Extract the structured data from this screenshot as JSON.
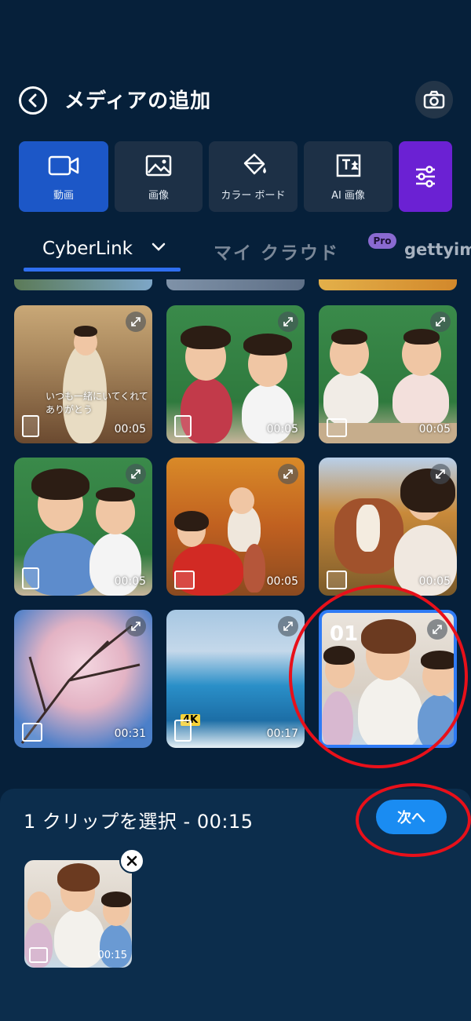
{
  "header": {
    "title": "メディアの追加"
  },
  "categories": [
    {
      "label": "動画",
      "icon": "video-camera-icon",
      "active": true
    },
    {
      "label": "画像",
      "icon": "image-icon",
      "active": false
    },
    {
      "label": "カラー ボード",
      "icon": "paint-bucket-icon",
      "active": false
    },
    {
      "label": "AI 画像",
      "icon": "ai-image-icon",
      "active": false
    },
    {
      "label": "",
      "icon": "filter-sliders-icon",
      "active": false
    }
  ],
  "tabs": {
    "cyberlink": "CyberLink",
    "cloud": "マイ クラウド",
    "pro": "Pro",
    "getty": "gettyimages"
  },
  "grid": [
    {
      "duration": "00:05",
      "overlay": "いつも一緒にいてくれて\nありがとう",
      "orientation": "vertical"
    },
    {
      "duration": "00:05",
      "orientation": "vertical"
    },
    {
      "duration": "00:05",
      "orientation": "horizontal"
    },
    {
      "duration": "00:05",
      "orientation": "vertical"
    },
    {
      "duration": "00:05",
      "orientation": "horizontal"
    },
    {
      "duration": "00:05",
      "orientation": "horizontal"
    },
    {
      "duration": "00:31",
      "orientation": "horizontal"
    },
    {
      "duration": "00:17",
      "badge": "4K",
      "orientation": "vertical"
    },
    {
      "selected_number": "01",
      "selected": true
    }
  ],
  "selection": {
    "summary": "1 クリップを選択 - 00:15",
    "next_label": "次へ",
    "clips": [
      {
        "duration": "00:15"
      }
    ]
  },
  "colors": {
    "accent": "#1a8cf2",
    "annotation": "#e8101a",
    "background": "#06203a"
  }
}
